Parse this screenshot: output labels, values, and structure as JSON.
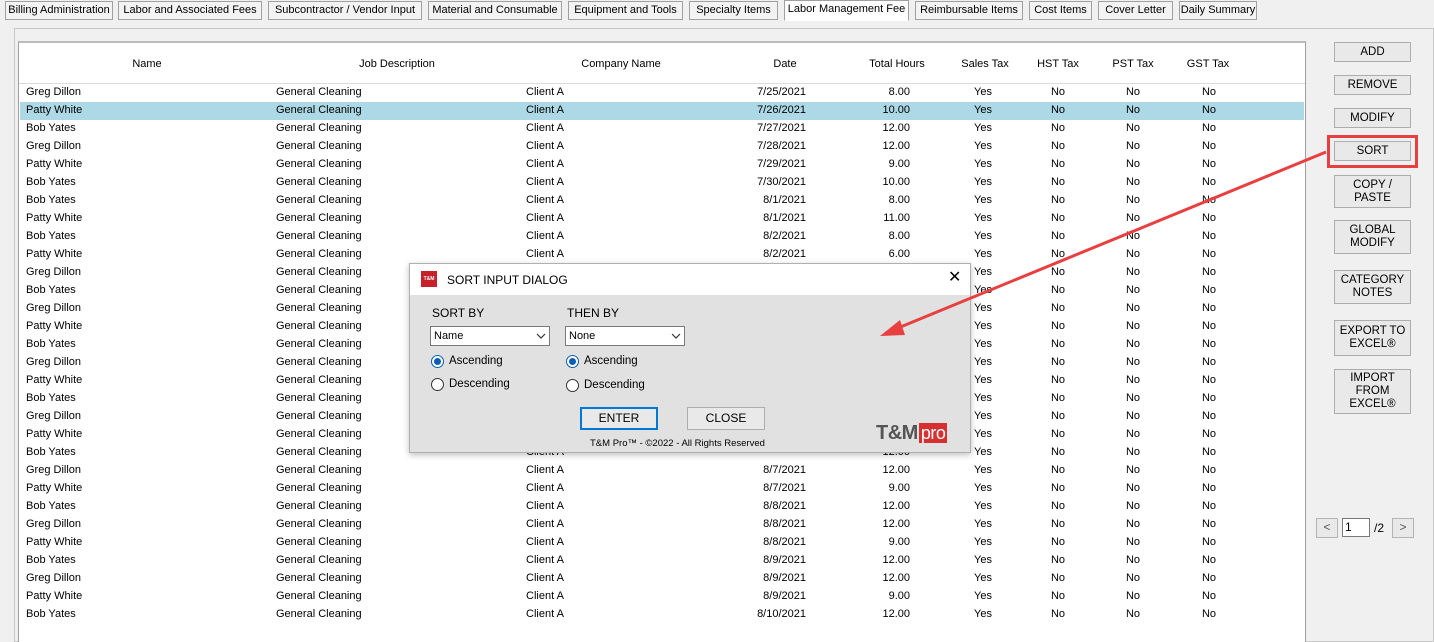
{
  "tabs": [
    {
      "label": "Billing Administration",
      "active": false
    },
    {
      "label": "Labor and Associated Fees",
      "active": false
    },
    {
      "label": "Subcontractor / Vendor Input",
      "active": false
    },
    {
      "label": "Material and Consumable",
      "active": false
    },
    {
      "label": "Equipment and Tools",
      "active": false
    },
    {
      "label": "Specialty Items",
      "active": false
    },
    {
      "label": "Labor Management Fee",
      "active": true
    },
    {
      "label": "Reimbursable Items",
      "active": false
    },
    {
      "label": "Cost Items",
      "active": false
    },
    {
      "label": "Cover Letter",
      "active": false
    },
    {
      "label": "Daily Summary",
      "active": false
    }
  ],
  "table": {
    "columns": [
      "Name",
      "Job Description",
      "Company Name",
      "Date",
      "Total Hours",
      "Sales Tax",
      "HST Tax",
      "PST Tax",
      "GST Tax"
    ],
    "selected_row": 1,
    "rows": [
      [
        "Greg Dillon",
        "General Cleaning",
        "Client A",
        "7/25/2021",
        "8.00",
        "Yes",
        "No",
        "No",
        "No"
      ],
      [
        "Patty White",
        "General Cleaning",
        "Client A",
        "7/26/2021",
        "10.00",
        "Yes",
        "No",
        "No",
        "No"
      ],
      [
        "Bob Yates",
        "General Cleaning",
        "Client A",
        "7/27/2021",
        "12.00",
        "Yes",
        "No",
        "No",
        "No"
      ],
      [
        "Greg Dillon",
        "General Cleaning",
        "Client A",
        "7/28/2021",
        "12.00",
        "Yes",
        "No",
        "No",
        "No"
      ],
      [
        "Patty White",
        "General Cleaning",
        "Client A",
        "7/29/2021",
        "9.00",
        "Yes",
        "No",
        "No",
        "No"
      ],
      [
        "Bob Yates",
        "General Cleaning",
        "Client A",
        "7/30/2021",
        "10.00",
        "Yes",
        "No",
        "No",
        "No"
      ],
      [
        "Bob Yates",
        "General Cleaning",
        "Client A",
        "8/1/2021",
        "8.00",
        "Yes",
        "No",
        "No",
        "No"
      ],
      [
        "Patty White",
        "General Cleaning",
        "Client A",
        "8/1/2021",
        "11.00",
        "Yes",
        "No",
        "No",
        "No"
      ],
      [
        "Bob Yates",
        "General Cleaning",
        "Client A",
        "8/2/2021",
        "8.00",
        "Yes",
        "No",
        "No",
        "No"
      ],
      [
        "Patty White",
        "General Cleaning",
        "Client A",
        "8/2/2021",
        "6.00",
        "Yes",
        "No",
        "No",
        "No"
      ],
      [
        "Greg Dillon",
        "General Cleaning",
        "",
        "",
        "",
        "Yes",
        "No",
        "No",
        "No"
      ],
      [
        "Bob Yates",
        "General Cleaning",
        "",
        "",
        "",
        "Yes",
        "No",
        "No",
        "No"
      ],
      [
        "Greg Dillon",
        "General Cleaning",
        "",
        "",
        "",
        "Yes",
        "No",
        "No",
        "No"
      ],
      [
        "Patty White",
        "General Cleaning",
        "",
        "",
        "",
        "Yes",
        "No",
        "No",
        "No"
      ],
      [
        "Bob Yates",
        "General Cleaning",
        "",
        "",
        "",
        "Yes",
        "No",
        "No",
        "No"
      ],
      [
        "Greg Dillon",
        "General Cleaning",
        "",
        "",
        "",
        "Yes",
        "No",
        "No",
        "No"
      ],
      [
        "Patty White",
        "General Cleaning",
        "",
        "",
        "",
        "Yes",
        "No",
        "No",
        "No"
      ],
      [
        "Bob Yates",
        "General Cleaning",
        "",
        "",
        "",
        "Yes",
        "No",
        "No",
        "No"
      ],
      [
        "Greg Dillon",
        "General Cleaning",
        "",
        "",
        "",
        "Yes",
        "No",
        "No",
        "No"
      ],
      [
        "Patty White",
        "General Cleaning",
        "",
        "",
        "",
        "Yes",
        "No",
        "No",
        "No"
      ],
      [
        "Bob Yates",
        "General Cleaning",
        "Client A",
        "",
        "12.00",
        "Yes",
        "No",
        "No",
        "No"
      ],
      [
        "Greg Dillon",
        "General Cleaning",
        "Client A",
        "8/7/2021",
        "12.00",
        "Yes",
        "No",
        "No",
        "No"
      ],
      [
        "Patty White",
        "General Cleaning",
        "Client A",
        "8/7/2021",
        "9.00",
        "Yes",
        "No",
        "No",
        "No"
      ],
      [
        "Bob Yates",
        "General Cleaning",
        "Client A",
        "8/8/2021",
        "12.00",
        "Yes",
        "No",
        "No",
        "No"
      ],
      [
        "Greg Dillon",
        "General Cleaning",
        "Client A",
        "8/8/2021",
        "12.00",
        "Yes",
        "No",
        "No",
        "No"
      ],
      [
        "Patty White",
        "General Cleaning",
        "Client A",
        "8/8/2021",
        "9.00",
        "Yes",
        "No",
        "No",
        "No"
      ],
      [
        "Bob Yates",
        "General Cleaning",
        "Client A",
        "8/9/2021",
        "12.00",
        "Yes",
        "No",
        "No",
        "No"
      ],
      [
        "Greg Dillon",
        "General Cleaning",
        "Client A",
        "8/9/2021",
        "12.00",
        "Yes",
        "No",
        "No",
        "No"
      ],
      [
        "Patty White",
        "General Cleaning",
        "Client A",
        "8/9/2021",
        "9.00",
        "Yes",
        "No",
        "No",
        "No"
      ],
      [
        "Bob Yates",
        "General Cleaning",
        "Client A",
        "8/10/2021",
        "12.00",
        "Yes",
        "No",
        "No",
        "No"
      ]
    ]
  },
  "side_buttons": {
    "add": "ADD",
    "remove": "REMOVE",
    "modify": "MODIFY",
    "sort": "SORT",
    "copy_paste": "COPY /\nPASTE",
    "global_modify": "GLOBAL\nMODIFY",
    "category_notes": "CATEGORY\nNOTES",
    "export_excel": "EXPORT TO\nEXCEL®",
    "import_excel": "IMPORT\nFROM\nEXCEL®"
  },
  "pager": {
    "prev": "<",
    "current_page": "1",
    "total": "/2",
    "next": ">"
  },
  "dialog": {
    "logo_text": "T&M",
    "title": "SORT INPUT DIALOG",
    "close_glyph": "✕",
    "sort_by_label": "SORT BY",
    "sort_by_value": "Name",
    "then_by_label": "THEN BY",
    "then_by_value": "None",
    "ascending": "Ascending",
    "descending": "Descending",
    "sort_by_order": "Ascending",
    "then_by_order": "Ascending",
    "enter_label": "ENTER",
    "close_label": "CLOSE",
    "copyright": "T&M Pro™ - ©2022 - All Rights Reserved",
    "brand_main": "T&M",
    "brand_pro": "pro"
  },
  "colors": {
    "selected_row": "#add8e6",
    "highlight": "#e84040",
    "brand_red": "#d63030"
  }
}
